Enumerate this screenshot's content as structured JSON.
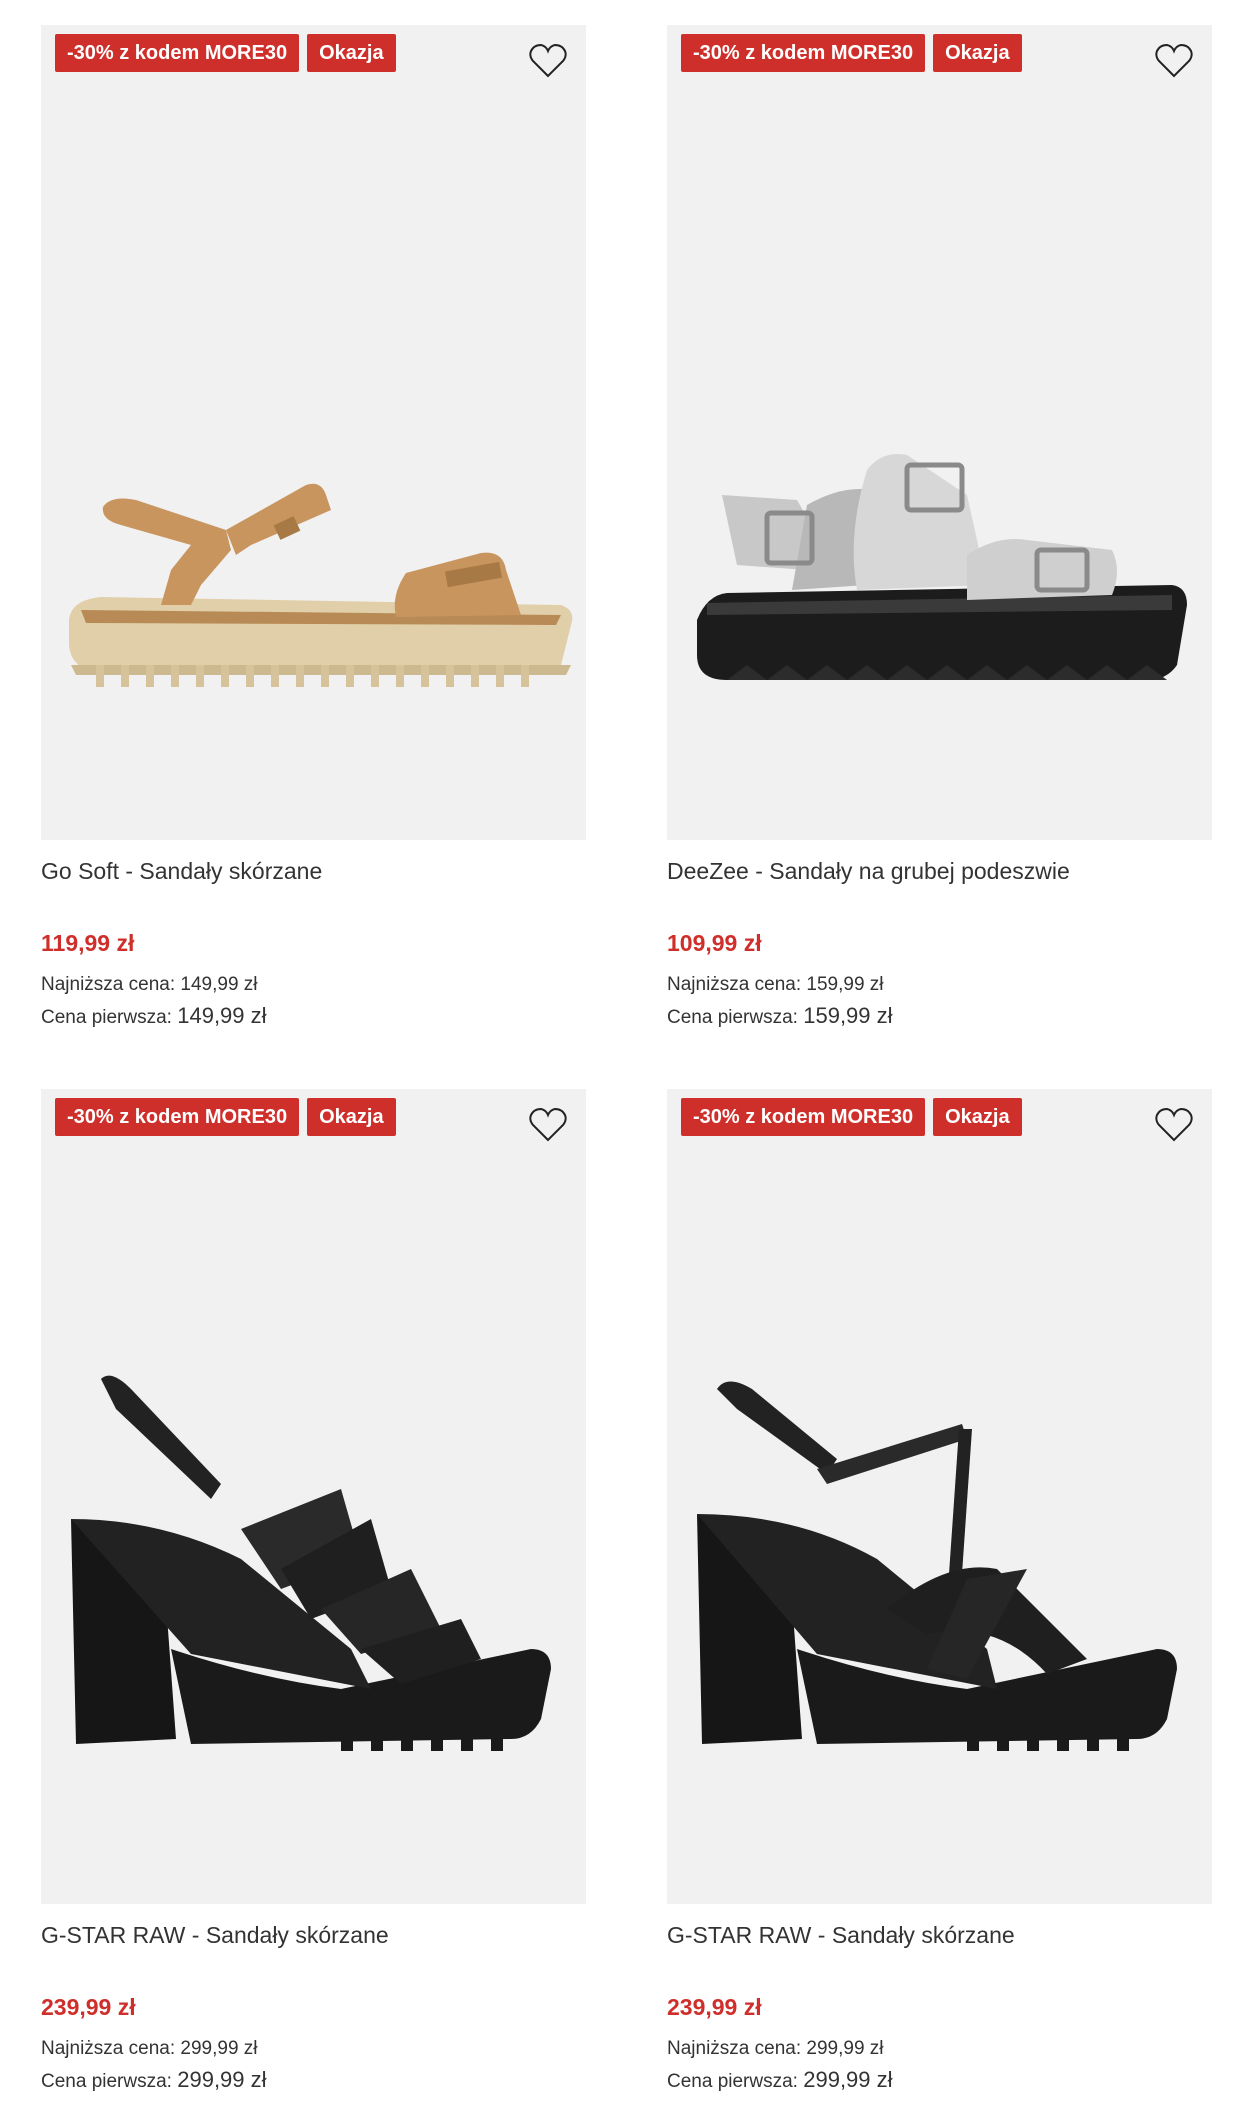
{
  "products": [
    {
      "promo_badge": "-30% z kodem MORE30",
      "deal_badge": "Okazja",
      "title": "Go Soft - Sandały skórzane",
      "price": "119,99 zł",
      "lowest_label": "Najniższa cena:",
      "lowest_value": "149,99 zł",
      "first_label": "Cena pierwsza:",
      "first_value": "149,99 zł",
      "image_icon": "beige-leather-sandal-image"
    },
    {
      "promo_badge": "-30% z kodem MORE30",
      "deal_badge": "Okazja",
      "title": "DeeZee - Sandały na grubej podeszwie",
      "price": "109,99 zł",
      "lowest_label": "Najniższa cena:",
      "lowest_value": "159,99 zł",
      "first_label": "Cena pierwsza:",
      "first_value": "159,99 zł",
      "image_icon": "silver-buckle-sandal-image"
    },
    {
      "promo_badge": "-30% z kodem MORE30",
      "deal_badge": "Okazja",
      "title": "G-STAR RAW - Sandały skórzane",
      "price": "239,99 zł",
      "lowest_label": "Najniższa cena:",
      "lowest_value": "299,99 zł",
      "first_label": "Cena pierwsza:",
      "first_value": "299,99 zł",
      "image_icon": "black-strappy-heel-sandal-image"
    },
    {
      "promo_badge": "-30% z kodem MORE30",
      "deal_badge": "Okazja",
      "title": "G-STAR RAW - Sandały skórzane",
      "price": "239,99 zł",
      "lowest_label": "Najniższa cena:",
      "lowest_value": "299,99 zł",
      "first_label": "Cena pierwsza:",
      "first_value": "299,99 zł",
      "image_icon": "black-t-strap-heel-sandal-image"
    }
  ],
  "colors": {
    "accent_red": "#cf2f2a",
    "photo_bg": "#f1f1f1",
    "text": "#333333"
  },
  "icons": {
    "favorite": "heart-outline-icon"
  }
}
